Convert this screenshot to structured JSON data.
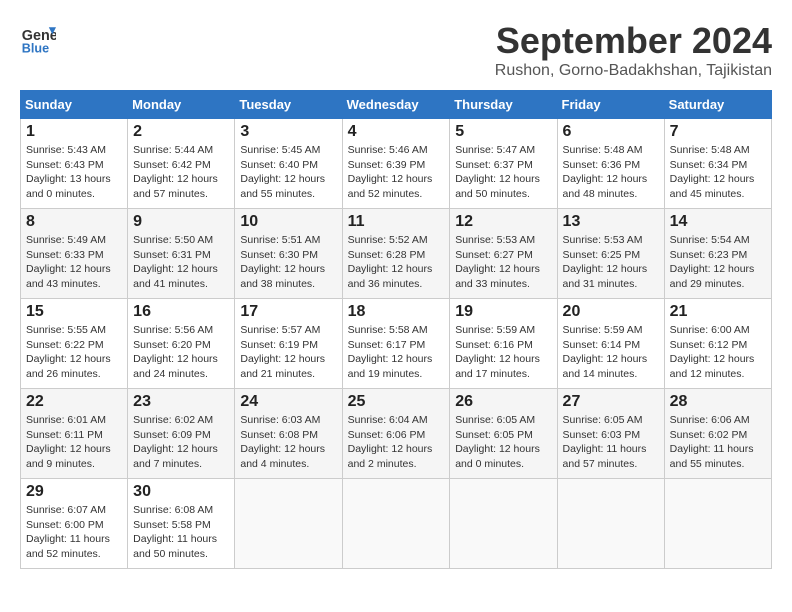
{
  "header": {
    "logo_line1": "General",
    "logo_line2": "Blue",
    "month": "September 2024",
    "location": "Rushon, Gorno-Badakhshan, Tajikistan"
  },
  "weekdays": [
    "Sunday",
    "Monday",
    "Tuesday",
    "Wednesday",
    "Thursday",
    "Friday",
    "Saturday"
  ],
  "weeks": [
    [
      {
        "day": "1",
        "sunrise": "5:43 AM",
        "sunset": "6:43 PM",
        "daylight": "13 hours and 0 minutes."
      },
      {
        "day": "2",
        "sunrise": "5:44 AM",
        "sunset": "6:42 PM",
        "daylight": "12 hours and 57 minutes."
      },
      {
        "day": "3",
        "sunrise": "5:45 AM",
        "sunset": "6:40 PM",
        "daylight": "12 hours and 55 minutes."
      },
      {
        "day": "4",
        "sunrise": "5:46 AM",
        "sunset": "6:39 PM",
        "daylight": "12 hours and 52 minutes."
      },
      {
        "day": "5",
        "sunrise": "5:47 AM",
        "sunset": "6:37 PM",
        "daylight": "12 hours and 50 minutes."
      },
      {
        "day": "6",
        "sunrise": "5:48 AM",
        "sunset": "6:36 PM",
        "daylight": "12 hours and 48 minutes."
      },
      {
        "day": "7",
        "sunrise": "5:48 AM",
        "sunset": "6:34 PM",
        "daylight": "12 hours and 45 minutes."
      }
    ],
    [
      {
        "day": "8",
        "sunrise": "5:49 AM",
        "sunset": "6:33 PM",
        "daylight": "12 hours and 43 minutes."
      },
      {
        "day": "9",
        "sunrise": "5:50 AM",
        "sunset": "6:31 PM",
        "daylight": "12 hours and 41 minutes."
      },
      {
        "day": "10",
        "sunrise": "5:51 AM",
        "sunset": "6:30 PM",
        "daylight": "12 hours and 38 minutes."
      },
      {
        "day": "11",
        "sunrise": "5:52 AM",
        "sunset": "6:28 PM",
        "daylight": "12 hours and 36 minutes."
      },
      {
        "day": "12",
        "sunrise": "5:53 AM",
        "sunset": "6:27 PM",
        "daylight": "12 hours and 33 minutes."
      },
      {
        "day": "13",
        "sunrise": "5:53 AM",
        "sunset": "6:25 PM",
        "daylight": "12 hours and 31 minutes."
      },
      {
        "day": "14",
        "sunrise": "5:54 AM",
        "sunset": "6:23 PM",
        "daylight": "12 hours and 29 minutes."
      }
    ],
    [
      {
        "day": "15",
        "sunrise": "5:55 AM",
        "sunset": "6:22 PM",
        "daylight": "12 hours and 26 minutes."
      },
      {
        "day": "16",
        "sunrise": "5:56 AM",
        "sunset": "6:20 PM",
        "daylight": "12 hours and 24 minutes."
      },
      {
        "day": "17",
        "sunrise": "5:57 AM",
        "sunset": "6:19 PM",
        "daylight": "12 hours and 21 minutes."
      },
      {
        "day": "18",
        "sunrise": "5:58 AM",
        "sunset": "6:17 PM",
        "daylight": "12 hours and 19 minutes."
      },
      {
        "day": "19",
        "sunrise": "5:59 AM",
        "sunset": "6:16 PM",
        "daylight": "12 hours and 17 minutes."
      },
      {
        "day": "20",
        "sunrise": "5:59 AM",
        "sunset": "6:14 PM",
        "daylight": "12 hours and 14 minutes."
      },
      {
        "day": "21",
        "sunrise": "6:00 AM",
        "sunset": "6:12 PM",
        "daylight": "12 hours and 12 minutes."
      }
    ],
    [
      {
        "day": "22",
        "sunrise": "6:01 AM",
        "sunset": "6:11 PM",
        "daylight": "12 hours and 9 minutes."
      },
      {
        "day": "23",
        "sunrise": "6:02 AM",
        "sunset": "6:09 PM",
        "daylight": "12 hours and 7 minutes."
      },
      {
        "day": "24",
        "sunrise": "6:03 AM",
        "sunset": "6:08 PM",
        "daylight": "12 hours and 4 minutes."
      },
      {
        "day": "25",
        "sunrise": "6:04 AM",
        "sunset": "6:06 PM",
        "daylight": "12 hours and 2 minutes."
      },
      {
        "day": "26",
        "sunrise": "6:05 AM",
        "sunset": "6:05 PM",
        "daylight": "12 hours and 0 minutes."
      },
      {
        "day": "27",
        "sunrise": "6:05 AM",
        "sunset": "6:03 PM",
        "daylight": "11 hours and 57 minutes."
      },
      {
        "day": "28",
        "sunrise": "6:06 AM",
        "sunset": "6:02 PM",
        "daylight": "11 hours and 55 minutes."
      }
    ],
    [
      {
        "day": "29",
        "sunrise": "6:07 AM",
        "sunset": "6:00 PM",
        "daylight": "11 hours and 52 minutes."
      },
      {
        "day": "30",
        "sunrise": "6:08 AM",
        "sunset": "5:58 PM",
        "daylight": "11 hours and 50 minutes."
      },
      null,
      null,
      null,
      null,
      null
    ]
  ]
}
